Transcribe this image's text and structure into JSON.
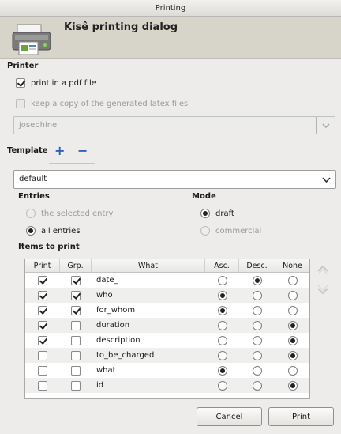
{
  "window": {
    "title": "Printing"
  },
  "banner": {
    "title": "Kisê printing dialog"
  },
  "printer": {
    "section_label": "Printer",
    "pdf_label": "print in a pdf file",
    "latex_label": "keep a copy of the generated latex files",
    "printer_name": "josephine"
  },
  "template": {
    "label": "Template",
    "add_symbol": "+",
    "remove_symbol": "−",
    "value": "default"
  },
  "entries": {
    "label": "Entries",
    "options": [
      "the selected entry",
      "all entries"
    ],
    "selected": "all entries"
  },
  "mode": {
    "label": "Mode",
    "options": [
      "draft",
      "commercial"
    ],
    "selected": "draft"
  },
  "items": {
    "label": "Items to print",
    "columns": [
      "Print",
      "Grp.",
      "What",
      "Asc.",
      "Desc.",
      "None"
    ],
    "rows": [
      {
        "what": "date_",
        "print": true,
        "grp": true,
        "sort": "desc"
      },
      {
        "what": "who",
        "print": true,
        "grp": true,
        "sort": "asc"
      },
      {
        "what": "for_whom",
        "print": true,
        "grp": true,
        "sort": "asc"
      },
      {
        "what": "duration",
        "print": true,
        "grp": false,
        "sort": "none"
      },
      {
        "what": "description",
        "print": true,
        "grp": false,
        "sort": "none"
      },
      {
        "what": "to_be_charged",
        "print": false,
        "grp": false,
        "sort": "none"
      },
      {
        "what": "what",
        "print": false,
        "grp": false,
        "sort": "asc"
      },
      {
        "what": "id",
        "print": false,
        "grp": false,
        "sort": "none"
      }
    ]
  },
  "buttons": {
    "cancel": "Cancel",
    "print": "Print"
  }
}
